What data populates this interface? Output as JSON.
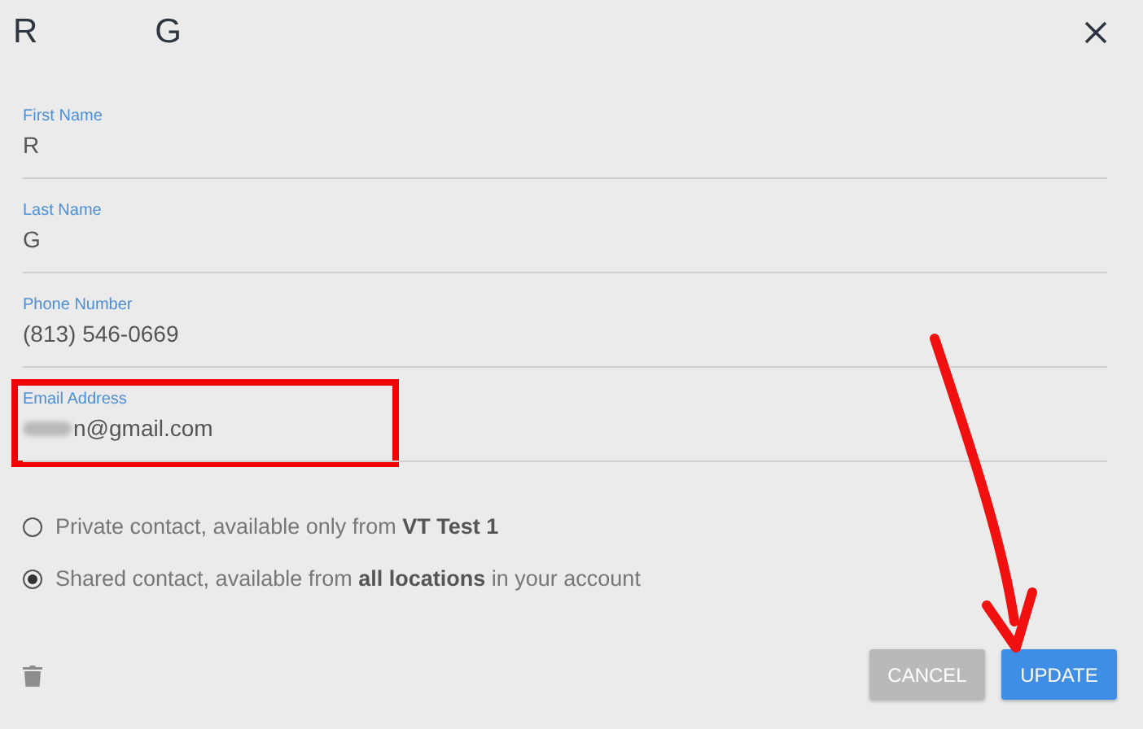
{
  "title_parts": [
    "R",
    "G"
  ],
  "fields": [
    {
      "label": "First Name",
      "value": "R",
      "redacted": false,
      "highlighted": false
    },
    {
      "label": "Last Name",
      "value": "G",
      "redacted": false,
      "highlighted": false
    },
    {
      "label": "Phone Number",
      "value": "(813) 546-0669",
      "redacted": false,
      "highlighted": false
    },
    {
      "label": "Email Address",
      "value": "n@gmail.com",
      "redacted": true,
      "highlighted": true
    }
  ],
  "visibility": [
    {
      "label": "Private contact, available only from **VT Test 1**",
      "selected": false
    },
    {
      "label": "Shared contact, available from **all locations** in your account",
      "selected": true
    }
  ],
  "buttons": [
    {
      "label": "CANCEL",
      "kind": "secondary"
    },
    {
      "label": "UPDATE",
      "kind": "primary"
    }
  ],
  "annotation_arrow": true
}
